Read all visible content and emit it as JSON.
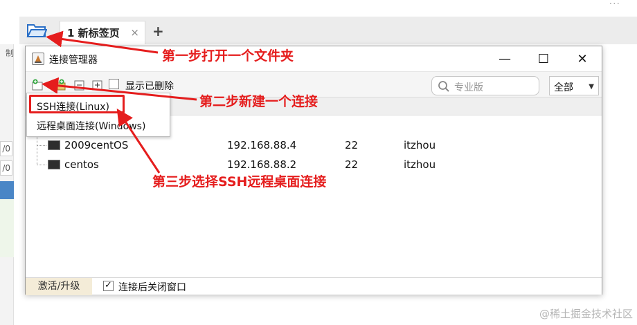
{
  "app": {
    "tab_title": "1 新标签页",
    "tab_close": "×",
    "new_tab": "+",
    "left_snippets": [
      "制",
      "/0",
      "/0"
    ]
  },
  "dialog": {
    "title": "连接管理器",
    "window_controls": {
      "minimize": "—",
      "maximize": "☐",
      "close": "✕"
    },
    "toolbar": {
      "show_deleted_label": "显示已删除",
      "search_placeholder": "专业版",
      "filter_selected": "全部"
    },
    "connections": [
      {
        "name": "2009centOS",
        "host": "192.168.88.4",
        "port": "22",
        "user": "itzhou"
      },
      {
        "name": "centos",
        "host": "192.168.88.2",
        "port": "22",
        "user": "itzhou"
      }
    ],
    "footer": {
      "activate_label": "激活/升级",
      "close_after_connect_checked": "✓",
      "close_after_connect_label": "连接后关闭窗口"
    }
  },
  "dropdown": {
    "items": [
      "SSH连接(Linux)",
      "远程桌面连接(Windows)"
    ]
  },
  "annotations": {
    "step1": "第一步打开一个文件夹",
    "step2": "第二步新建一个连接",
    "step3": "第三步选择SSH远程桌面连接",
    "color": "#e51d1d"
  },
  "watermark": "@稀土掘金技术社区"
}
